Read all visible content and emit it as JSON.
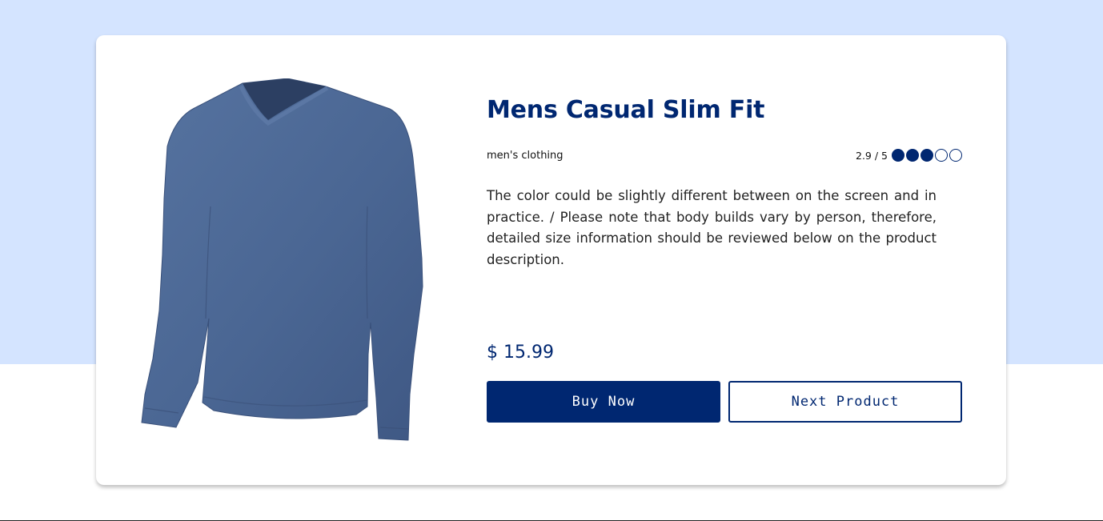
{
  "product": {
    "title": "Mens Casual Slim Fit",
    "category": "men's clothing",
    "rating": {
      "value": 2.9,
      "max": 5,
      "label": "2.9 / 5",
      "filled_dots": 3
    },
    "description": "The color could be slightly different between on the screen and in practice. / Please note that body builds vary by person, therefore, detailed size information should be reviewed below on the product description.",
    "price": "$ 15.99",
    "image": {
      "subject": "blue long-sleeve v-neck t-shirt",
      "color": "#4a6693"
    }
  },
  "actions": {
    "buy_label": "Buy Now",
    "next_label": "Next Product"
  },
  "colors": {
    "accent": "#002771",
    "page_background_top": "#d4e4ff",
    "card_background": "#ffffff"
  }
}
